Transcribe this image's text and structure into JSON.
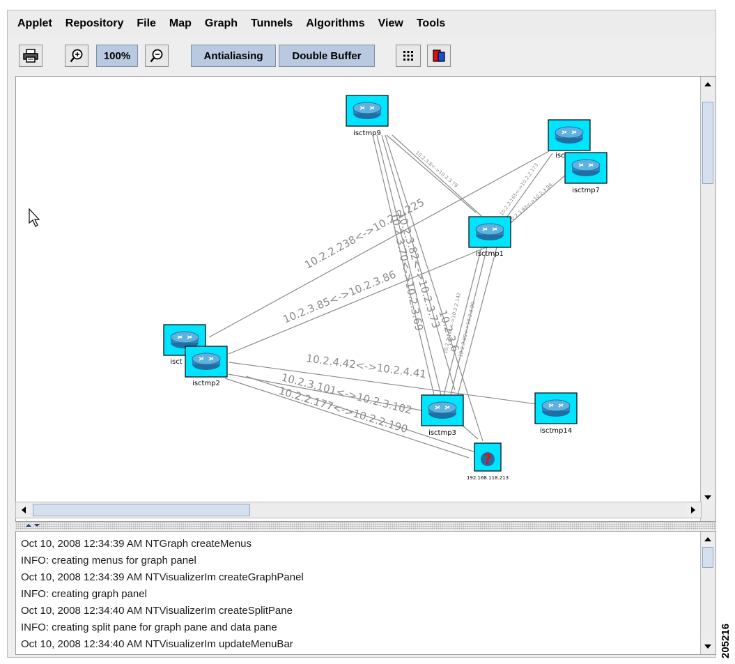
{
  "menu": [
    "Applet",
    "Repository",
    "File",
    "Map",
    "Graph",
    "Tunnels",
    "Algorithms",
    "View",
    "Tools"
  ],
  "toolbar": {
    "print_icon": "printer-icon",
    "zoom_in_icon": "zoom-in-icon",
    "zoom_level": "100%",
    "zoom_out_icon": "zoom-out-icon",
    "antialiasing_label": "Antialiasing",
    "double_buffer_label": "Double Buffer",
    "grid_icon": "grid-icon",
    "layers_icon": "layers-icon"
  },
  "graph": {
    "nodes": [
      {
        "id": "isctmp9",
        "label": "isctmp9",
        "type": "router"
      },
      {
        "id": "isctmp8",
        "label": "isctmp8",
        "type": "router"
      },
      {
        "id": "isctmp7",
        "label": "isctmp7",
        "type": "router"
      },
      {
        "id": "isctmp1",
        "label": "isctmp1",
        "type": "router"
      },
      {
        "id": "isct",
        "label": "isct",
        "type": "router"
      },
      {
        "id": "isctmp2",
        "label": "isctmp2",
        "type": "router"
      },
      {
        "id": "isctmp3",
        "label": "isctmp3",
        "type": "router"
      },
      {
        "id": "isctmp14",
        "label": "isctmp14",
        "type": "router"
      },
      {
        "id": "unknown",
        "label": "192.168.118.213",
        "type": "unknown"
      }
    ],
    "edges": [
      {
        "from": "isct",
        "to": "isctmp8",
        "label": "10.2.2.238<->10.2.2.225"
      },
      {
        "from": "isctmp2",
        "to": "isctmp1",
        "label": "10.2.3.85<->10.2.3.86"
      },
      {
        "from": "isctmp2",
        "to": "isctmp14",
        "label": "10.2.4.42<->10.2.4.41"
      },
      {
        "from": "isctmp2",
        "to": "isctmp3",
        "label": "10.2.3.101<->10.2.3.102"
      },
      {
        "from": "isctmp2",
        "to": "unknown",
        "label": "10.2.2.177<->10.2.2.190"
      },
      {
        "from": "isctmp9",
        "to": "isctmp3",
        "label": "10.2.3.70<->10.2.3.69"
      },
      {
        "from": "isctmp9",
        "to": "isctmp3",
        "label": "10.2.3.82<->10.2.3.73"
      },
      {
        "from": "isctmp9",
        "to": "unknown",
        "label": "10.2.3.6"
      },
      {
        "from": "isctmp9",
        "to": "isctmp1",
        "label": "10.2.3.8<->10.2.3.79"
      },
      {
        "from": "isctmp8",
        "to": "isctmp1",
        "label": "10.2.2.165<->10.2.2.173"
      },
      {
        "from": "isctmp7",
        "to": "isctmp1",
        "label": "10.2.3.93<->10.2.3.94"
      },
      {
        "from": "isctmp1",
        "to": "isctmp3",
        "label": "10.2.3.89<->10.2.3.90"
      },
      {
        "from": "isctmp1",
        "to": "isctmp3",
        "label": "10.2.2.141<->10.2.2.142"
      }
    ]
  },
  "log": [
    "Oct 10, 2008 12:34:39 AM NTGraph createMenus",
    "INFO: creating menus for graph panel",
    "Oct 10, 2008 12:34:39 AM NTVisualizerIm createGraphPanel",
    "INFO: creating graph panel",
    "Oct 10, 2008 12:34:40 AM NTVisualizerIm createSplitPane",
    "INFO: creating split pane for graph pane and data pane",
    "Oct 10, 2008 12:34:40 AM NTVisualizerIm updateMenuBar"
  ],
  "figure_id": "205216",
  "colors": {
    "node_fill": "#00e5ff",
    "router_blue": "#3a8fc4",
    "unknown_red": "#e01010",
    "edge": "#8a8a8a",
    "selected_button": "#b8c9e0"
  }
}
